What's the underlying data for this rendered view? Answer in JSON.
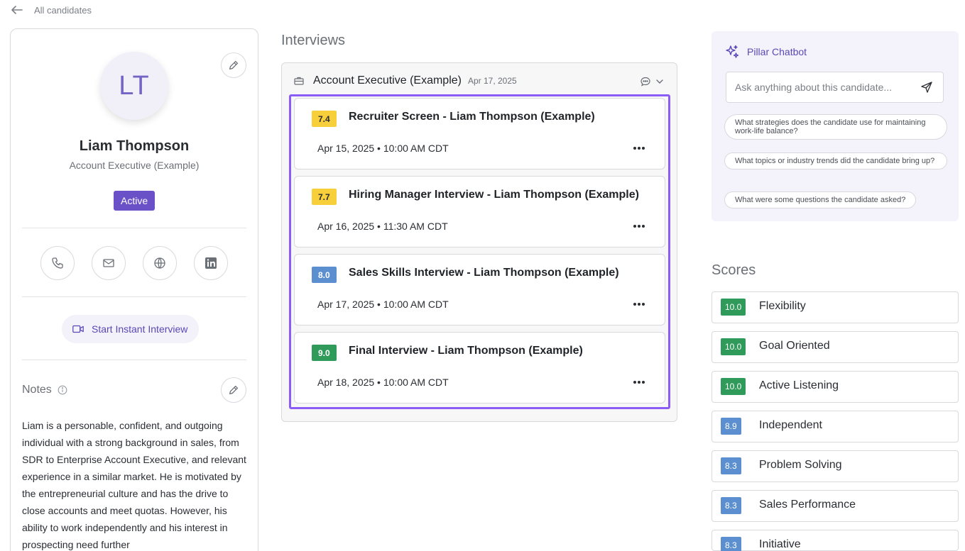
{
  "nav": {
    "back_label": "All candidates"
  },
  "candidate": {
    "initials": "LT",
    "name": "Liam Thompson",
    "role": "Account Executive (Example)",
    "status": "Active",
    "instant_interview_label": "Start Instant Interview",
    "notes_title": "Notes",
    "notes": "Liam is a personable, confident, and outgoing individual with a strong background in sales, from SDR to Enterprise Account Executive, and relevant experience in a similar market. He is motivated by the entrepreneurial culture and has the drive to close accounts and meet quotas. However, his ability to work independently and his interest in prospecting need further"
  },
  "interviews": {
    "title": "Interviews",
    "job": {
      "title": "Account Executive (Example)",
      "date": "Apr 17, 2025"
    },
    "items": [
      {
        "score": "7.4",
        "title": "Recruiter Screen - Liam Thompson (Example)",
        "date": "Apr 15, 2025 • 10:00 AM CDT",
        "color": "#f7cf3b",
        "text_color": "#2a2d32"
      },
      {
        "score": "7.7",
        "title": "Hiring Manager Interview - Liam Thompson (Example)",
        "date": "Apr 16, 2025 • 11:30 AM CDT",
        "color": "#f7cf3b",
        "text_color": "#2a2d32"
      },
      {
        "score": "8.0",
        "title": "Sales Skills Interview - Liam Thompson (Example)",
        "date": "Apr 17, 2025 • 10:00 AM CDT",
        "color": "#5b8fd0",
        "text_color": "#ffffff"
      },
      {
        "score": "9.0",
        "title": "Final Interview - Liam Thompson (Example)",
        "date": "Apr 18, 2025 • 10:00 AM CDT",
        "color": "#2f9a5a",
        "text_color": "#ffffff"
      }
    ]
  },
  "chatbot": {
    "title": "Pillar Chatbot",
    "placeholder": "Ask anything about this candidate...",
    "suggestions": [
      "What strategies does the candidate use for maintaining work-life balance?",
      "What topics or industry trends did the candidate bring up?",
      "What were some questions the candidate asked?"
    ]
  },
  "scores": {
    "title": "Scores",
    "items": [
      {
        "value": "10.0",
        "name": "Flexibility",
        "color": "#2f9a5a"
      },
      {
        "value": "10.0",
        "name": "Goal Oriented",
        "color": "#2f9a5a"
      },
      {
        "value": "10.0",
        "name": "Active Listening",
        "color": "#2f9a5a"
      },
      {
        "value": "8.9",
        "name": "Independent",
        "color": "#5b8fd0"
      },
      {
        "value": "8.3",
        "name": "Problem Solving",
        "color": "#5b8fd0"
      },
      {
        "value": "8.3",
        "name": "Sales Performance",
        "color": "#5b8fd0"
      },
      {
        "value": "8.3",
        "name": "Initiative",
        "color": "#5b8fd0"
      }
    ]
  }
}
